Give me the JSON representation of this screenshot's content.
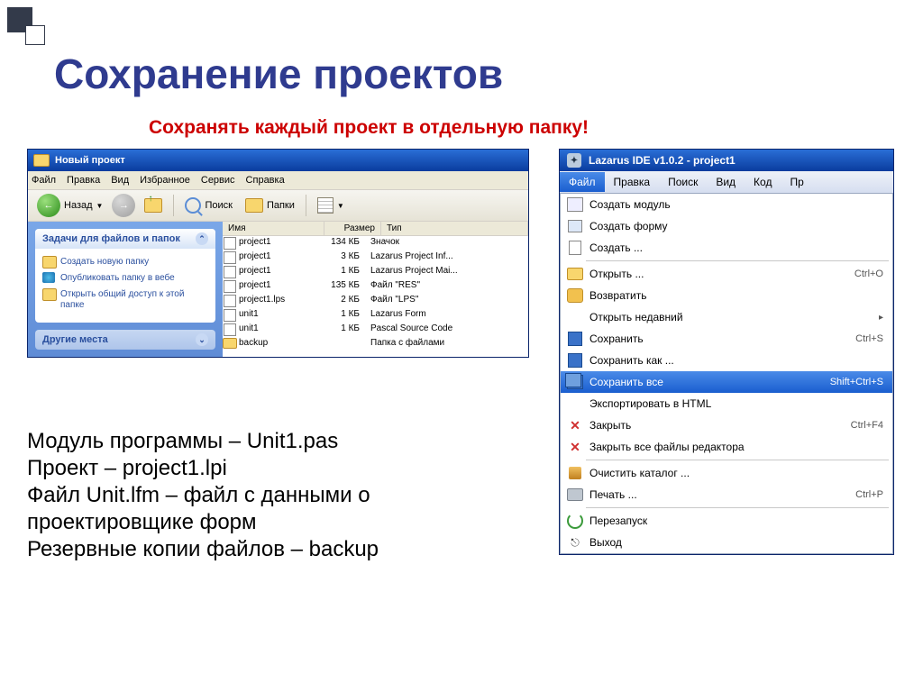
{
  "slide": {
    "title": "Сохранение проектов",
    "subtitle": "Сохранять каждый проект в отдельную папку!"
  },
  "explorer": {
    "title": "Новый проект",
    "menu": [
      "Файл",
      "Правка",
      "Вид",
      "Избранное",
      "Сервис",
      "Справка"
    ],
    "toolbar": {
      "back": "Назад",
      "search": "Поиск",
      "folders": "Папки"
    },
    "tasks": {
      "header": "Задачи для файлов и папок",
      "items": [
        "Создать новую папку",
        "Опубликовать папку в вебе",
        "Открыть общий доступ к этой папке"
      ],
      "other": "Другие места"
    },
    "columns": {
      "name": "Имя",
      "size": "Размер",
      "type": "Тип"
    },
    "files": [
      {
        "name": "project1",
        "size": "134 КБ",
        "type": "Значок"
      },
      {
        "name": "project1",
        "size": "3 КБ",
        "type": "Lazarus Project Inf..."
      },
      {
        "name": "project1",
        "size": "1 КБ",
        "type": "Lazarus Project Mai..."
      },
      {
        "name": "project1",
        "size": "135 КБ",
        "type": "Файл \"RES\""
      },
      {
        "name": "project1.lps",
        "size": "2 КБ",
        "type": "Файл \"LPS\""
      },
      {
        "name": "unit1",
        "size": "1 КБ",
        "type": "Lazarus Form"
      },
      {
        "name": "unit1",
        "size": "1 КБ",
        "type": "Pascal Source Code"
      },
      {
        "name": "backup",
        "size": "",
        "type": "Папка с файлами",
        "folder": true
      }
    ]
  },
  "ide": {
    "title": "Lazarus IDE v1.0.2 - project1",
    "menubar": [
      "Файл",
      "Правка",
      "Поиск",
      "Вид",
      "Код",
      "Пр"
    ],
    "items": [
      {
        "icon": "box",
        "label": "Создать модуль"
      },
      {
        "icon": "form",
        "label": "Создать форму"
      },
      {
        "icon": "doc",
        "label": "Создать ..."
      },
      {
        "sep": true
      },
      {
        "icon": "open",
        "label": "Открыть ...",
        "key": "Ctrl+O"
      },
      {
        "icon": "lion",
        "label": "Возвратить"
      },
      {
        "icon": "",
        "label": "Открыть недавний",
        "sub": "▸"
      },
      {
        "icon": "save",
        "label": "Сохранить",
        "key": "Ctrl+S"
      },
      {
        "icon": "save",
        "label": "Сохранить как ..."
      },
      {
        "icon": "saveall",
        "label": "Сохранить все",
        "key": "Shift+Ctrl+S",
        "selected": true
      },
      {
        "icon": "",
        "label": "Экспортировать в HTML"
      },
      {
        "icon": "close",
        "label": "Закрыть",
        "key": "Ctrl+F4"
      },
      {
        "icon": "close",
        "label": "Закрыть все файлы редактора"
      },
      {
        "sep": true
      },
      {
        "icon": "clean",
        "label": "Очистить каталог ..."
      },
      {
        "icon": "print",
        "label": "Печать ...",
        "key": "Ctrl+P"
      },
      {
        "sep": true
      },
      {
        "icon": "restart",
        "label": "Перезапуск"
      },
      {
        "icon": "exit",
        "label": "Выход"
      }
    ]
  },
  "body": {
    "l1": "Модуль программы – Unit1.pas",
    "l2": "Проект – project1.lpi",
    "l3": "Файл Unit.lfm – файл с данными о",
    "l4": "проектировщике форм",
    "l5": "Резервные копии файлов – backup"
  }
}
